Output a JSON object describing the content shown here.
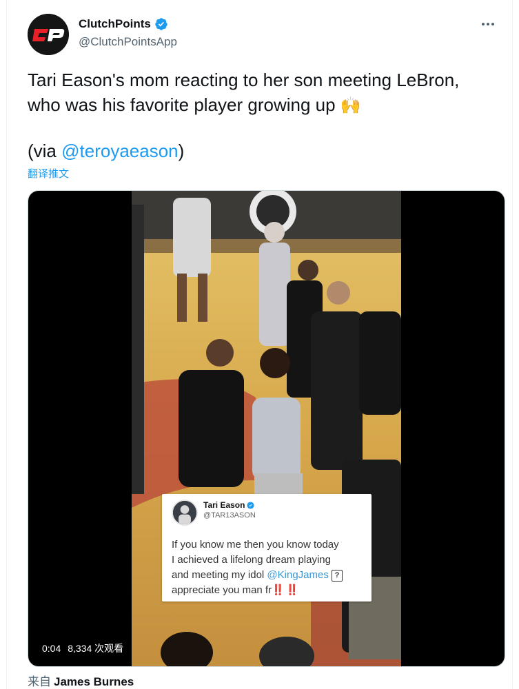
{
  "author": {
    "name": "ClutchPoints",
    "handle": "@ClutchPointsApp",
    "avatar_icon": "clutchpoints-logo",
    "verified": true
  },
  "tweet": {
    "line1": "Tari Eason's mom reacting to her son meeting LeBron,",
    "line2": "who was his favorite player growing up",
    "emoji": "🙌",
    "via_prefix": "(via ",
    "via_mention": "@teroyaeason",
    "via_suffix": ")",
    "translate_label": "翻译推文"
  },
  "media": {
    "embedded_tweet": {
      "name": "Tari Eason",
      "handle": "@TAR13ASON",
      "line1": "If you know me then you know today",
      "line2": "I achieved a lifelong dream playing",
      "line3_prefix": "and meeting my idol ",
      "line3_mention": "@KingJames",
      "line3_box": "?",
      "line4_prefix": "appreciate you man fr",
      "line4_bangs": "‼️ ‼️"
    },
    "timestamp": "0:04",
    "views": "8,334 次观看"
  },
  "footer": {
    "from_label": "来自",
    "from_name": "James Burnes"
  },
  "colors": {
    "accent": "#1d9bf0",
    "text": "#0f1419",
    "secondary": "#536471"
  }
}
